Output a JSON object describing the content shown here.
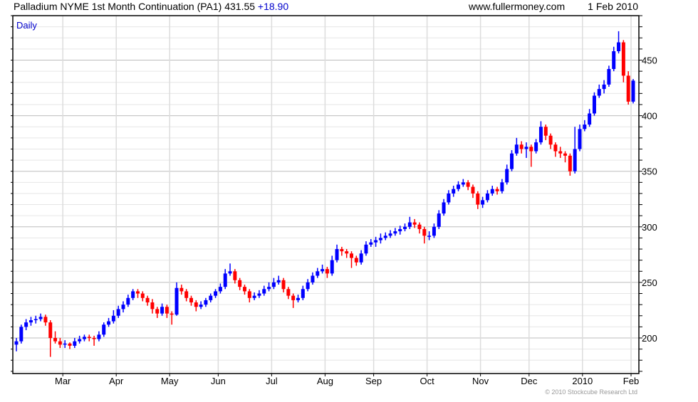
{
  "header": {
    "title": "Palladium NYME 1st Month Continuation (PA1) 431.55",
    "change": "+18.90",
    "site": "www.fullermoney.com",
    "date": "1 Feb 2010"
  },
  "footer": {
    "copyright": "© 2010 Stockcube Research Ltd"
  },
  "colors": {
    "up": "#0000ff",
    "down": "#ff0000",
    "period_label": "#0000cc",
    "change": "#0000cc"
  },
  "chart_data": {
    "type": "candlestick",
    "period_label": "Daily",
    "ylim": [
      168,
      490
    ],
    "y_ticks": [
      200,
      250,
      300,
      350,
      400,
      450
    ],
    "y_minor_step": 10,
    "grid": true,
    "y_axis_side": "right",
    "x_ticks": [
      {
        "label": "Mar",
        "index": 10
      },
      {
        "label": "Apr",
        "index": 21
      },
      {
        "label": "May",
        "index": 32
      },
      {
        "label": "Jun",
        "index": 42
      },
      {
        "label": "Jul",
        "index": 53
      },
      {
        "label": "Aug",
        "index": 64
      },
      {
        "label": "Sep",
        "index": 74
      },
      {
        "label": "Oct",
        "index": 85
      },
      {
        "label": "Nov",
        "index": 96
      },
      {
        "label": "Dec",
        "index": 106
      },
      {
        "label": "2010",
        "index": 117
      },
      {
        "label": "Feb",
        "index": 127
      }
    ],
    "ohlc_fields": [
      "open",
      "high",
      "low",
      "close"
    ],
    "ohlc": [
      [
        194,
        200,
        188,
        197
      ],
      [
        197,
        212,
        195,
        210
      ],
      [
        210,
        217,
        207,
        214
      ],
      [
        214,
        219,
        211,
        216
      ],
      [
        216,
        220,
        213,
        217
      ],
      [
        217,
        222,
        215,
        219
      ],
      [
        219,
        221,
        211,
        214
      ],
      [
        214,
        216,
        183,
        200
      ],
      [
        200,
        206,
        195,
        197
      ],
      [
        197,
        200,
        191,
        194
      ],
      [
        194,
        198,
        191,
        195
      ],
      [
        195,
        196,
        190,
        193
      ],
      [
        193,
        200,
        191,
        197
      ],
      [
        197,
        202,
        195,
        199
      ],
      [
        199,
        203,
        197,
        201
      ],
      [
        201,
        203,
        197,
        200
      ],
      [
        200,
        202,
        193,
        199
      ],
      [
        199,
        206,
        197,
        203
      ],
      [
        203,
        214,
        201,
        212
      ],
      [
        212,
        218,
        210,
        215
      ],
      [
        215,
        225,
        213,
        220
      ],
      [
        220,
        229,
        218,
        226
      ],
      [
        226,
        233,
        223,
        230
      ],
      [
        230,
        239,
        228,
        236
      ],
      [
        236,
        244,
        234,
        242
      ],
      [
        242,
        244,
        236,
        240
      ],
      [
        240,
        242,
        233,
        236
      ],
      [
        236,
        238,
        229,
        232
      ],
      [
        232,
        235,
        222,
        226
      ],
      [
        226,
        228,
        218,
        222
      ],
      [
        222,
        231,
        220,
        228
      ],
      [
        228,
        230,
        218,
        222
      ],
      [
        222,
        224,
        212,
        221
      ],
      [
        221,
        250,
        220,
        245
      ],
      [
        245,
        248,
        239,
        242
      ],
      [
        242,
        244,
        233,
        236
      ],
      [
        236,
        238,
        229,
        232
      ],
      [
        232,
        234,
        224,
        228
      ],
      [
        228,
        233,
        226,
        230
      ],
      [
        230,
        236,
        228,
        234
      ],
      [
        234,
        240,
        232,
        238
      ],
      [
        238,
        244,
        236,
        242
      ],
      [
        242,
        249,
        240,
        246
      ],
      [
        246,
        262,
        244,
        258
      ],
      [
        258,
        267,
        256,
        260
      ],
      [
        260,
        262,
        249,
        252
      ],
      [
        252,
        254,
        243,
        246
      ],
      [
        246,
        248,
        239,
        242
      ],
      [
        242,
        244,
        232,
        236
      ],
      [
        236,
        241,
        234,
        238
      ],
      [
        238,
        243,
        236,
        240
      ],
      [
        240,
        247,
        238,
        244
      ],
      [
        244,
        250,
        242,
        246
      ],
      [
        246,
        254,
        244,
        250
      ],
      [
        250,
        256,
        248,
        252
      ],
      [
        252,
        254,
        241,
        244
      ],
      [
        244,
        246,
        235,
        238
      ],
      [
        238,
        240,
        227,
        234
      ],
      [
        234,
        239,
        232,
        236
      ],
      [
        236,
        247,
        234,
        244
      ],
      [
        244,
        253,
        242,
        250
      ],
      [
        250,
        259,
        248,
        256
      ],
      [
        256,
        263,
        254,
        260
      ],
      [
        260,
        266,
        258,
        262
      ],
      [
        262,
        264,
        254,
        258
      ],
      [
        258,
        274,
        256,
        270
      ],
      [
        270,
        284,
        268,
        280
      ],
      [
        280,
        282,
        274,
        278
      ],
      [
        278,
        280,
        272,
        276
      ],
      [
        276,
        278,
        263,
        272
      ],
      [
        272,
        274,
        265,
        268
      ],
      [
        268,
        279,
        266,
        276
      ],
      [
        276,
        287,
        274,
        284
      ],
      [
        284,
        289,
        282,
        286
      ],
      [
        286,
        291,
        282,
        288
      ],
      [
        288,
        294,
        285,
        290
      ],
      [
        290,
        295,
        288,
        292
      ],
      [
        292,
        297,
        290,
        294
      ],
      [
        294,
        299,
        292,
        296
      ],
      [
        296,
        301,
        293,
        298
      ],
      [
        298,
        303,
        296,
        300
      ],
      [
        300,
        309,
        298,
        304
      ],
      [
        304,
        307,
        299,
        302
      ],
      [
        302,
        304,
        294,
        298
      ],
      [
        298,
        300,
        285,
        292
      ],
      [
        291,
        296,
        288,
        292
      ],
      [
        292,
        303,
        290,
        300
      ],
      [
        300,
        315,
        298,
        312
      ],
      [
        312,
        325,
        310,
        322
      ],
      [
        322,
        333,
        320,
        330
      ],
      [
        330,
        337,
        327,
        334
      ],
      [
        334,
        341,
        332,
        338
      ],
      [
        338,
        343,
        336,
        340
      ],
      [
        340,
        342,
        333,
        336
      ],
      [
        336,
        338,
        326,
        330
      ],
      [
        330,
        332,
        316,
        320
      ],
      [
        320,
        327,
        317,
        324
      ],
      [
        324,
        333,
        322,
        330
      ],
      [
        330,
        337,
        328,
        334
      ],
      [
        334,
        336,
        329,
        332
      ],
      [
        332,
        343,
        330,
        340
      ],
      [
        340,
        356,
        338,
        352
      ],
      [
        352,
        369,
        350,
        366
      ],
      [
        366,
        380,
        364,
        374
      ],
      [
        374,
        377,
        366,
        370
      ],
      [
        370,
        376,
        362,
        372
      ],
      [
        372,
        374,
        354,
        368
      ],
      [
        368,
        379,
        366,
        376
      ],
      [
        376,
        395,
        374,
        390
      ],
      [
        390,
        392,
        378,
        382
      ],
      [
        382,
        384,
        370,
        374
      ],
      [
        374,
        376,
        363,
        368
      ],
      [
        368,
        372,
        362,
        366
      ],
      [
        366,
        368,
        358,
        364
      ],
      [
        364,
        366,
        346,
        350
      ],
      [
        350,
        390,
        348,
        370
      ],
      [
        370,
        392,
        368,
        388
      ],
      [
        388,
        396,
        386,
        392
      ],
      [
        392,
        406,
        390,
        402
      ],
      [
        402,
        421,
        400,
        418
      ],
      [
        418,
        428,
        416,
        424
      ],
      [
        424,
        432,
        420,
        428
      ],
      [
        428,
        445,
        426,
        442
      ],
      [
        442,
        462,
        440,
        458
      ],
      [
        458,
        476,
        456,
        466
      ],
      [
        466,
        468,
        430,
        436
      ],
      [
        436,
        440,
        410,
        412.65
      ],
      [
        412.65,
        433,
        411,
        431.55
      ]
    ]
  }
}
